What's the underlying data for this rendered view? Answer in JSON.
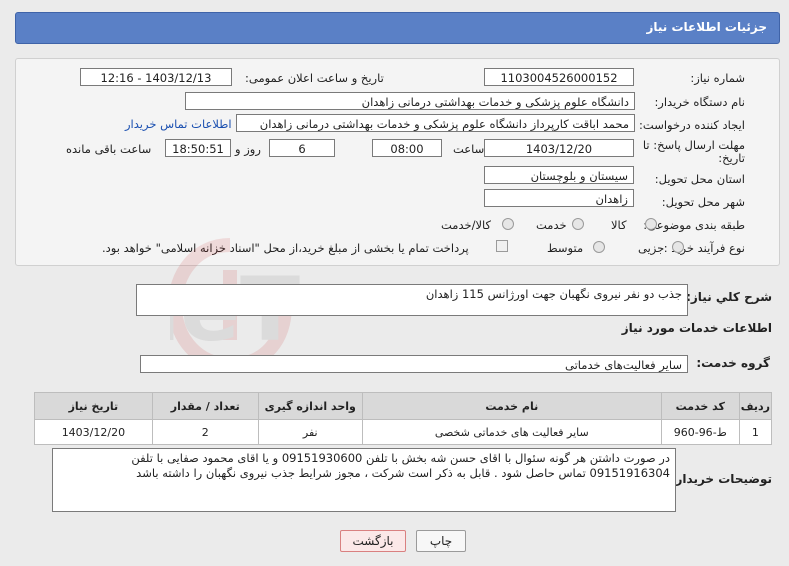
{
  "header": {
    "title": "جزئیات اطلاعات نیاز"
  },
  "labels": {
    "need_number": "شماره نیاز:",
    "announce_datetime": "تاریخ و ساعت اعلان عمومی:",
    "buyer_org": "نام دستگاه خریدار:",
    "requester": "ایجاد کننده درخواست:",
    "contact_link": "اطلاعات تماس خریدار",
    "deadline": "مهلت ارسال پاسخ: تا",
    "deadline_cont": "تاریخ:",
    "time": "ساعت",
    "day_and": "روز و",
    "remaining": "ساعت باقی مانده",
    "province": "استان محل تحویل:",
    "city": "شهر محل تحویل:",
    "category": "طبقه بندی موضوعی:",
    "process_type": "نوع فرآیند خرید :",
    "need_summary": "شرح کلي نياز:",
    "services_heading": "اطلاعات خدمات مورد نیاز",
    "service_group": "گروه خدمت:",
    "buyer_notes": "توضیحات خریدار:"
  },
  "values": {
    "need_number": "1103004526000152",
    "announce_datetime": "1403/12/13 - 12:16",
    "buyer_org": "دانشگاه علوم پزشکی و خدمات بهداشتی درمانی زاهدان",
    "requester": "محمد اباقت کارپرداز دانشگاه علوم پزشکی و خدمات بهداشتی درمانی زاهدان",
    "deadline_date": "1403/12/20",
    "deadline_time": "08:00",
    "days": "6",
    "remaining_time": "18:50:51",
    "province": "سیستان و بلوچستان",
    "city": "زاهدان",
    "need_summary": "جذب دو نفر نیروی نگهبان جهت اورژانس 115 زاهدان",
    "service_group": "سایر فعالیت‌های خدماتی",
    "buyer_notes": "در صورت داشتن هر گونه سئوال با اقای حسن شه بخش با تلفن 09151930600 و یا اقای محمود صفایی با تلفن 09151916304 تماس حاصل شود . قابل به ذکر است شرکت ، مجوز شرایط جذب نیروی نگهبان را داشته باشد"
  },
  "category_options": [
    "کالا",
    "خدمت",
    "کالا/خدمت"
  ],
  "process_options": [
    "جزیی",
    "متوسط"
  ],
  "payment_note": "پرداخت تمام یا بخشی از مبلغ خرید،از محل \"اسناد خزانه اسلامی\" خواهد بود.",
  "table": {
    "headers": [
      "ردیف",
      "کد خدمت",
      "نام خدمت",
      "واحد اندازه گیری",
      "تعداد / مقدار",
      "تاریخ نیاز"
    ],
    "rows": [
      [
        "1",
        "ط-96-960",
        "سایر فعالیت های خدماتی شخصی",
        "نفر",
        "2",
        "1403/12/20"
      ]
    ]
  },
  "buttons": {
    "print": "چاپ",
    "back": "بازگشت"
  },
  "watermark": {
    "brand": "AriaTender.neT"
  },
  "colors": {
    "header": "#5a80c6",
    "link": "#1a4fb0",
    "back_button_border": "#d98080"
  }
}
